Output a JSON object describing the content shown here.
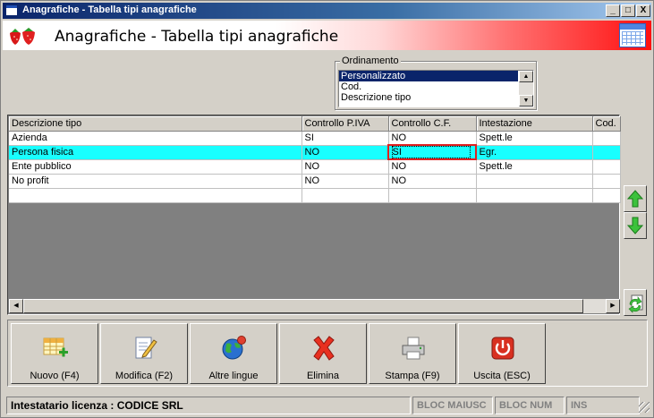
{
  "window": {
    "title": "Anagrafiche - Tabella tipi anagrafiche",
    "controls": {
      "minimize": "_",
      "maximize": "□",
      "close": "X"
    }
  },
  "banner": {
    "title": "Anagrafiche - Tabella tipi anagrafiche",
    "icon_left": "strawberries-icon",
    "icon_right": "calendar-icon"
  },
  "ordering": {
    "legend": "Ordinamento",
    "options": [
      "Personalizzato",
      "Cod.",
      "Descrizione tipo"
    ],
    "selected": "Personalizzato"
  },
  "grid": {
    "columns": [
      "Descrizione tipo",
      "Controllo P.IVA",
      "Controllo C.F.",
      "Intestazione",
      "Cod."
    ],
    "rows": [
      {
        "descrizione": "Azienda",
        "piva": "SI",
        "cf": "NO",
        "intestazione": "Spett.le",
        "cod": ""
      },
      {
        "descrizione": "Persona fisica",
        "piva": "NO",
        "cf": "SI",
        "intestazione": "Egr.",
        "cod": ""
      },
      {
        "descrizione": "Ente pubblico",
        "piva": "NO",
        "cf": "NO",
        "intestazione": "Spett.le",
        "cod": ""
      },
      {
        "descrizione": "No profit",
        "piva": "NO",
        "cf": "NO",
        "intestazione": "",
        "cod": ""
      },
      {
        "descrizione": "",
        "piva": "",
        "cf": "",
        "intestazione": "",
        "cod": ""
      }
    ],
    "selected_row": "Persona fisica"
  },
  "side_buttons": [
    "move-up-icon",
    "move-down-icon",
    "refresh-icon"
  ],
  "toolbar": {
    "buttons": [
      {
        "label": "Nuovo (F4)",
        "icon": "new-grid-icon"
      },
      {
        "label": "Modifica (F2)",
        "icon": "edit-document-icon"
      },
      {
        "label": "Altre lingue",
        "icon": "globe-icon"
      },
      {
        "label": "Elimina",
        "icon": "delete-x-icon"
      },
      {
        "label": "Stampa (F9)",
        "icon": "printer-icon"
      },
      {
        "label": "Uscita (ESC)",
        "icon": "power-icon"
      }
    ]
  },
  "status": {
    "license": "Intestatario licenza : CODICE SRL",
    "caps": "BLOC MAIUSC",
    "num": "BLOC NUM",
    "ins": "INS"
  },
  "colors": {
    "selected_row": "#19ffff",
    "highlight_border": "#e02020",
    "title_bar": "#0a246a"
  }
}
